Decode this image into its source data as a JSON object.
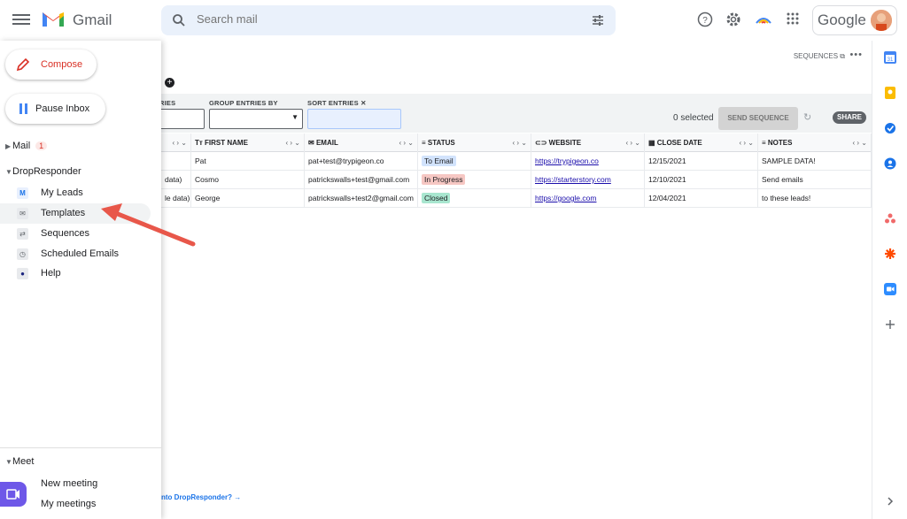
{
  "app": {
    "name": "Gmail",
    "account_brand": "Google"
  },
  "search": {
    "placeholder": "Search mail"
  },
  "sidebar": {
    "compose_label": "Compose",
    "pause_label": "Pause Inbox",
    "mail_label": "Mail",
    "mail_count": "1",
    "dropresponder_label": "DropResponder",
    "items": [
      {
        "label": "My Leads",
        "icon": "m-icon"
      },
      {
        "label": "Templates",
        "icon": "template-icon"
      },
      {
        "label": "Sequences",
        "icon": "sequence-icon"
      },
      {
        "label": "Scheduled Emails",
        "icon": "clock-icon"
      },
      {
        "label": "Help",
        "icon": "help-icon"
      }
    ],
    "meet_label": "Meet",
    "meet_items": [
      {
        "label": "New meeting"
      },
      {
        "label": "My meetings"
      }
    ]
  },
  "main": {
    "sequences_link": "SEQUENCES",
    "filters": {
      "entries_label": "RIES",
      "group_label": "GROUP ENTRIES BY",
      "sort_label": "SORT ENTRIES",
      "selected_text": "0 selected",
      "send_label": "SEND SEQUENCE",
      "share_label": "SHARE"
    },
    "columns": [
      "FIRST NAME",
      "EMAIL",
      "STATUS",
      "WEBSITE",
      "CLOSE DATE",
      "NOTES"
    ],
    "rows": [
      {
        "first": "",
        "name": "Pat",
        "email": "pat+test@trypigeon.co",
        "status": "To Email",
        "website": "https://trypigeon.co",
        "date": "12/15/2021",
        "notes": "SAMPLE DATA!"
      },
      {
        "first": "data)",
        "name": "Cosmo",
        "email": "patrickswalls+test@gmail.com",
        "status": "In Progress",
        "website": "https://starterstory.com",
        "date": "12/10/2021",
        "notes": "Send emails"
      },
      {
        "first": "le data)",
        "name": "George",
        "email": "patrickswalls+test2@gmail.com",
        "status": "Closed",
        "website": "https://google.com",
        "date": "12/04/2021",
        "notes": "to these leads!"
      }
    ],
    "footer_link": "nto DropResponder? →"
  },
  "colors": {
    "accent_red": "#d93025",
    "status_to_email": "#d2e3fc",
    "status_in_progress": "#f6c7c3",
    "status_closed": "#a8e6cf",
    "arrow": "#e8574a"
  }
}
